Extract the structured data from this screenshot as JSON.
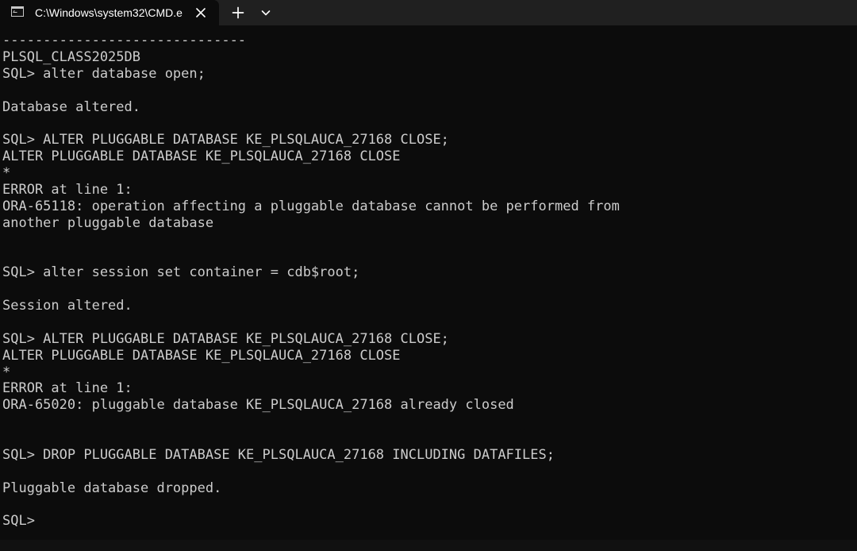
{
  "window": {
    "tab_title": "C:\\Windows\\system32\\CMD.e",
    "tab_icon": "console-icon",
    "close_icon": "close-icon",
    "new_tab_icon": "plus-icon",
    "dropdown_icon": "chevron-down-icon"
  },
  "terminal": {
    "lines": [
      "------------------------------",
      "PLSQL_CLASS2025DB",
      "SQL> alter database open;",
      "",
      "Database altered.",
      "",
      "SQL> ALTER PLUGGABLE DATABASE KE_PLSQLAUCA_27168 CLOSE;",
      "ALTER PLUGGABLE DATABASE KE_PLSQLAUCA_27168 CLOSE",
      "*",
      "ERROR at line 1:",
      "ORA-65118: operation affecting a pluggable database cannot be performed from",
      "another pluggable database",
      "",
      "",
      "SQL> alter session set container = cdb$root;",
      "",
      "Session altered.",
      "",
      "SQL> ALTER PLUGGABLE DATABASE KE_PLSQLAUCA_27168 CLOSE;",
      "ALTER PLUGGABLE DATABASE KE_PLSQLAUCA_27168 CLOSE",
      "*",
      "ERROR at line 1:",
      "ORA-65020: pluggable database KE_PLSQLAUCA_27168 already closed",
      "",
      "",
      "SQL> DROP PLUGGABLE DATABASE KE_PLSQLAUCA_27168 INCLUDING DATAFILES;",
      "",
      "Pluggable database dropped.",
      "",
      "SQL>"
    ]
  },
  "colors": {
    "terminal_background": "#0c0c0c",
    "titlebar_background": "#202020",
    "text": "#cccccc",
    "tab_text": "#ffffff"
  }
}
